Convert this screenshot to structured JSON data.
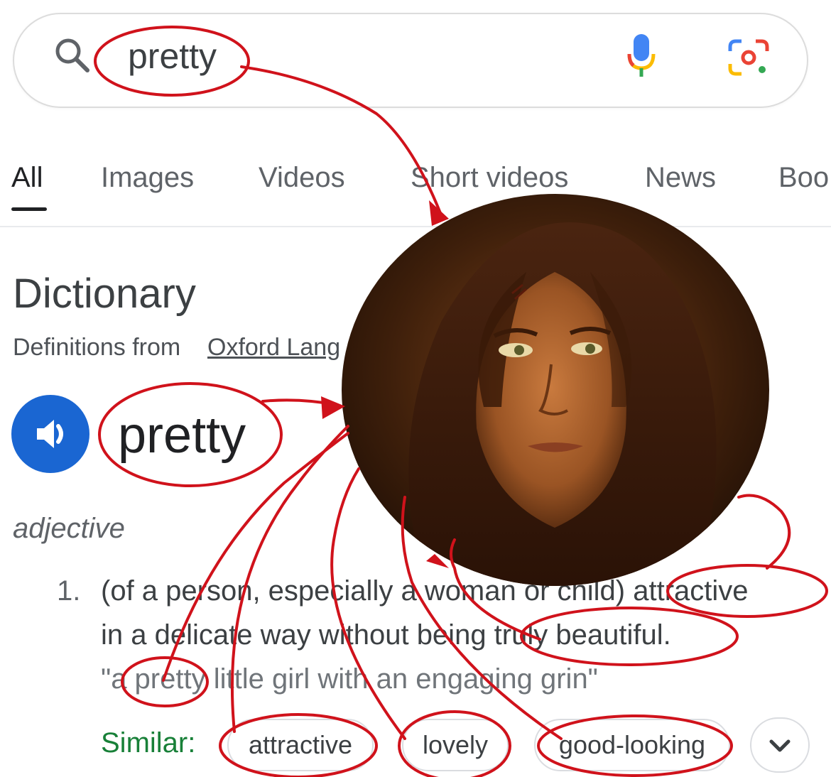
{
  "search": {
    "query": "pretty",
    "icons": [
      "search-icon",
      "mic-icon",
      "google-lens-icon"
    ]
  },
  "tabs": [
    {
      "label": "All",
      "active": true
    },
    {
      "label": "Images",
      "active": false
    },
    {
      "label": "Videos",
      "active": false
    },
    {
      "label": "Short videos",
      "active": false
    },
    {
      "label": "News",
      "active": false
    },
    {
      "label": "Boo",
      "active": false
    }
  ],
  "dictionary": {
    "title": "Dictionary",
    "source_prefix": "Definitions from",
    "source_link": "Oxford Lang",
    "word": "pretty",
    "part_of_speech": "adjective",
    "sense_number": "1.",
    "definition_lines": [
      "(of a person, especially a woman or child) attractive",
      "in a delicate way without being truly beautiful."
    ],
    "example": "\"a pretty little girl with an engaging grin\"",
    "similar_label": "Similar:",
    "similar": [
      "attractive",
      "lovely",
      "good-looking"
    ]
  },
  "colors": {
    "accent_blue": "#1a66d2",
    "annotation_red": "#d0121b",
    "similar_green": "#188038"
  }
}
